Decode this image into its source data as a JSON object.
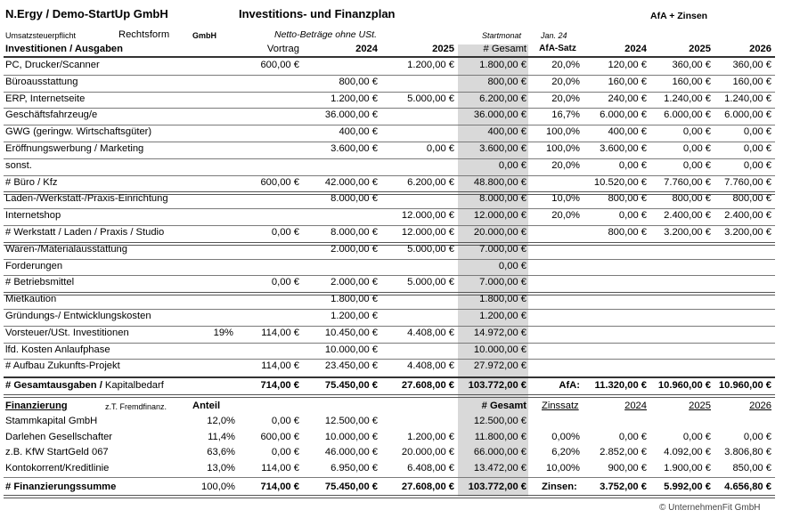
{
  "header": {
    "company": "N.Ergy / Demo-StartUp GmbH",
    "plan_title": "Investitions- und Finanzplan",
    "afa_title": "AfA + Zinsen",
    "tax_label": "Umsatzsteuerpflicht",
    "legal_form_label": "Rechtsform",
    "legal_form_value": "GmbH",
    "net_note": "Netto-Beträge ohne USt.",
    "start_label": "Startmonat",
    "start_value": "Jan. 24"
  },
  "invest_header": {
    "label": "Investitionen / Ausgaben",
    "vortrag": "Vortrag",
    "y2024": "2024",
    "y2025": "2025",
    "gesamt": "# Gesamt",
    "afa_satz": "AfA-Satz",
    "a2024": "2024",
    "a2025": "2025",
    "a2026": "2026"
  },
  "invest_rows": [
    {
      "label": "PC, Drucker/Scanner",
      "pct": "",
      "vortrag": "600,00 €",
      "y2024": "",
      "y2025": "1.200,00 €",
      "gesamt": "1.800,00 €",
      "afa": "20,0%",
      "a2024": "120,00 €",
      "a2025": "360,00 €",
      "a2026": "360,00 €"
    },
    {
      "label": "Büroausstattung",
      "pct": "",
      "vortrag": "",
      "y2024": "800,00 €",
      "y2025": "",
      "gesamt": "800,00 €",
      "afa": "20,0%",
      "a2024": "160,00 €",
      "a2025": "160,00 €",
      "a2026": "160,00 €"
    },
    {
      "label": "ERP, Internetseite",
      "pct": "",
      "vortrag": "",
      "y2024": "1.200,00 €",
      "y2025": "5.000,00 €",
      "gesamt": "6.200,00 €",
      "afa": "20,0%",
      "a2024": "240,00 €",
      "a2025": "1.240,00 €",
      "a2026": "1.240,00 €"
    },
    {
      "label": "Geschäftsfahrzeug/e",
      "pct": "",
      "vortrag": "",
      "y2024": "36.000,00 €",
      "y2025": "",
      "gesamt": "36.000,00 €",
      "afa": "16,7%",
      "a2024": "6.000,00 €",
      "a2025": "6.000,00 €",
      "a2026": "6.000,00 €"
    },
    {
      "label": "GWG (geringw. Wirtschaftsgüter)",
      "pct": "",
      "vortrag": "",
      "y2024": "400,00 €",
      "y2025": "",
      "gesamt": "400,00 €",
      "afa": "100,0%",
      "a2024": "400,00 €",
      "a2025": "0,00 €",
      "a2026": "0,00 €"
    },
    {
      "label": "Eröffnungswerbung / Marketing",
      "pct": "",
      "vortrag": "",
      "y2024": "3.600,00 €",
      "y2025": "0,00 €",
      "gesamt": "3.600,00 €",
      "afa": "100,0%",
      "a2024": "3.600,00 €",
      "a2025": "0,00 €",
      "a2026": "0,00 €"
    },
    {
      "label": "sonst.",
      "pct": "",
      "vortrag": "",
      "y2024": "",
      "y2025": "",
      "gesamt": "0,00 €",
      "afa": "20,0%",
      "a2024": "0,00 €",
      "a2025": "0,00 €",
      "a2026": "0,00 €"
    },
    {
      "label": "# Büro / Kfz",
      "pct": "",
      "vortrag": "600,00 €",
      "y2024": "42.000,00 €",
      "y2025": "6.200,00 €",
      "gesamt": "48.800,00 €",
      "afa": "",
      "a2024": "10.520,00 €",
      "a2025": "7.760,00 €",
      "a2026": "7.760,00 €"
    },
    {
      "label": "Laden-/Werkstatt-/Praxis-Einrichtung",
      "pct": "",
      "vortrag": "",
      "y2024": "8.000,00 €",
      "y2025": "",
      "gesamt": "8.000,00 €",
      "afa": "10,0%",
      "a2024": "800,00 €",
      "a2025": "800,00 €",
      "a2026": "800,00 €"
    },
    {
      "label": "Internetshop",
      "pct": "",
      "vortrag": "",
      "y2024": "",
      "y2025": "12.000,00 €",
      "gesamt": "12.000,00 €",
      "afa": "20,0%",
      "a2024": "0,00 €",
      "a2025": "2.400,00 €",
      "a2026": "2.400,00 €"
    },
    {
      "label": "# Werkstatt / Laden / Praxis / Studio",
      "pct": "",
      "vortrag": "0,00 €",
      "y2024": "8.000,00 €",
      "y2025": "12.000,00 €",
      "gesamt": "20.000,00 €",
      "afa": "",
      "a2024": "800,00 €",
      "a2025": "3.200,00 €",
      "a2026": "3.200,00 €"
    },
    {
      "label": "Waren-/Materialausstattung",
      "pct": "",
      "vortrag": "",
      "y2024": "2.000,00 €",
      "y2025": "5.000,00 €",
      "gesamt": "7.000,00 €",
      "afa": "",
      "a2024": "",
      "a2025": "",
      "a2026": ""
    },
    {
      "label": "Forderungen",
      "pct": "",
      "vortrag": "",
      "y2024": "",
      "y2025": "",
      "gesamt": "0,00 €",
      "afa": "",
      "a2024": "",
      "a2025": "",
      "a2026": ""
    },
    {
      "label": "# Betriebsmittel",
      "pct": "",
      "vortrag": "0,00 €",
      "y2024": "2.000,00 €",
      "y2025": "5.000,00 €",
      "gesamt": "7.000,00 €",
      "afa": "",
      "a2024": "",
      "a2025": "",
      "a2026": ""
    },
    {
      "label": "Mietkaution",
      "pct": "",
      "vortrag": "",
      "y2024": "1.800,00 €",
      "y2025": "",
      "gesamt": "1.800,00 €",
      "afa": "",
      "a2024": "",
      "a2025": "",
      "a2026": ""
    },
    {
      "label": "Gründungs-/ Entwicklungskosten",
      "pct": "",
      "vortrag": "",
      "y2024": "1.200,00 €",
      "y2025": "",
      "gesamt": "1.200,00 €",
      "afa": "",
      "a2024": "",
      "a2025": "",
      "a2026": ""
    },
    {
      "label": "Vorsteuer/USt. Investitionen",
      "pct": "19%",
      "vortrag": "114,00 €",
      "y2024": "10.450,00 €",
      "y2025": "4.408,00 €",
      "gesamt": "14.972,00 €",
      "afa": "",
      "a2024": "",
      "a2025": "",
      "a2026": ""
    },
    {
      "label": "lfd. Kosten Anlaufphase",
      "pct": "",
      "vortrag": "",
      "y2024": "10.000,00 €",
      "y2025": "",
      "gesamt": "10.000,00 €",
      "afa": "",
      "a2024": "",
      "a2025": "",
      "a2026": ""
    },
    {
      "label": "# Aufbau Zukunfts-Projekt",
      "pct": "",
      "vortrag": "114,00 €",
      "y2024": "23.450,00 €",
      "y2025": "4.408,00 €",
      "gesamt": "27.972,00 €",
      "afa": "",
      "a2024": "",
      "a2025": "",
      "a2026": ""
    }
  ],
  "invest_total": {
    "label_a": "# Gesamtausgaben /",
    "label_b": " Kapitalbedarf",
    "vortrag": "714,00 €",
    "y2024": "75.450,00 €",
    "y2025": "27.608,00 €",
    "gesamt": "103.772,00 €",
    "afa_label": "AfA:",
    "a2024": "11.320,00 €",
    "a2025": "10.960,00 €",
    "a2026": "10.960,00 €"
  },
  "fin_header": {
    "label": "Finanzierung",
    "note": "z.T. Fremdfinanz.",
    "anteil": "Anteil",
    "gesamt": "# Gesamt",
    "zinssatz": "Zinssatz",
    "z2024": "2024",
    "z2025": "2025",
    "z2026": "2026"
  },
  "fin_rows": [
    {
      "label": "Stammkapital GmbH",
      "anteil": "12,0%",
      "vortrag": "0,00 €",
      "y2024": "12.500,00 €",
      "y2025": "",
      "gesamt": "12.500,00 €",
      "zins": "",
      "z2024": "",
      "z2025": "",
      "z2026": ""
    },
    {
      "label": "Darlehen Gesellschafter",
      "anteil": "11,4%",
      "vortrag": "600,00 €",
      "y2024": "10.000,00 €",
      "y2025": "1.200,00 €",
      "gesamt": "11.800,00 €",
      "zins": "0,00%",
      "z2024": "0,00 €",
      "z2025": "0,00 €",
      "z2026": "0,00 €"
    },
    {
      "label": "z.B. KfW StartGeld 067",
      "anteil": "63,6%",
      "vortrag": "0,00 €",
      "y2024": "46.000,00 €",
      "y2025": "20.000,00 €",
      "gesamt": "66.000,00 €",
      "zins": "6,20%",
      "z2024": "2.852,00 €",
      "z2025": "4.092,00 €",
      "z2026": "3.806,80 €"
    },
    {
      "label": "Kontokorrent/Kreditlinie",
      "anteil": "13,0%",
      "vortrag": "114,00 €",
      "y2024": "6.950,00 €",
      "y2025": "6.408,00 €",
      "gesamt": "13.472,00 €",
      "zins": "10,00%",
      "z2024": "900,00 €",
      "z2025": "1.900,00 €",
      "z2026": "850,00 €"
    }
  ],
  "fin_total": {
    "label": "# Finanzierungssumme",
    "anteil": "100,0%",
    "vortrag": "714,00 €",
    "y2024": "75.450,00 €",
    "y2025": "27.608,00 €",
    "gesamt": "103.772,00 €",
    "zins_label": "Zinsen:",
    "z2024": "3.752,00 €",
    "z2025": "5.992,00 €",
    "z2026": "4.656,80 €"
  },
  "footer": {
    "copyright": "© UnternehmenFit GmbH"
  }
}
